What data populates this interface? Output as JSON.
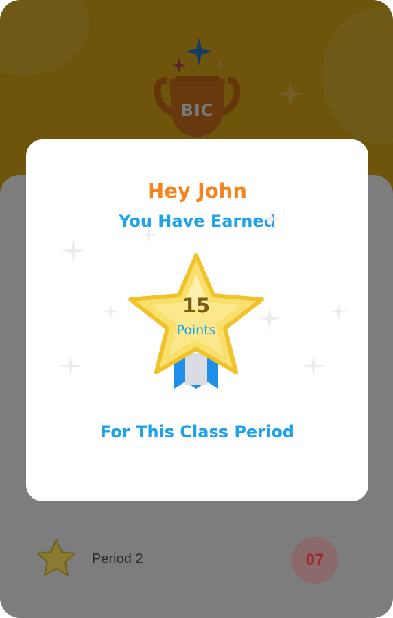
{
  "header": {
    "trophy_label": "BIC",
    "trophy_icon": "trophy-icon",
    "sparkle_icon": "sparkle-icon"
  },
  "list": {
    "items": [
      {
        "label": "Period 2",
        "value": "07",
        "icon": "star-icon"
      }
    ]
  },
  "modal": {
    "greeting": "Hey John",
    "subtitle": "You Have Earned",
    "points_value": "15",
    "points_label": "Points",
    "footer": "For This Class Period",
    "medal_icon": "star-medal-icon"
  },
  "colors": {
    "hero_background": "#dcaa17",
    "greeting": "#f5841f",
    "accent_blue": "#1fa2ec",
    "star_gold": "#f7d23a",
    "ribbon_blue": "#1f8fea",
    "badge_text": "#9c2b2b"
  }
}
